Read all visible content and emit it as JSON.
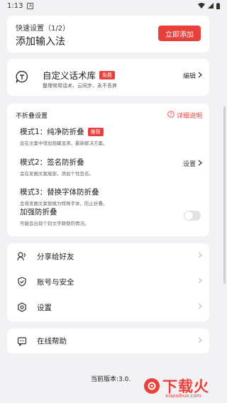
{
  "status_bar": {
    "time": "1:13",
    "notification_icon": "A"
  },
  "quick_setup": {
    "subtitle": "快速设置（1/2）",
    "title": "添加输入法",
    "button_label": "立即添加"
  },
  "phrase_library": {
    "title": "自定义话术库",
    "badge": "免费",
    "description": "整理常用话术、云同步、永不丢弃",
    "edit_label": "编辑"
  },
  "anti_fold": {
    "header": "不折叠设置",
    "help_label": "详细说明",
    "modes": [
      {
        "name": "模式1：纯净防折叠",
        "badge": "推荐",
        "description": "会在文案中增加隐藏混淆，最新解决方案。"
      },
      {
        "name": "模式2：签名防折叠",
        "description": "会在发圈文案尾部，添加个性签名。",
        "action_label": "设置"
      },
      {
        "name": "模式3：替换字体防折叠",
        "description": "会将发圈文案替换为特殊字体，防止折叠。"
      }
    ],
    "enhanced": {
      "name": "加强防折叠",
      "description": "可能会出现个别文字颠倒的情况。",
      "enabled": false
    }
  },
  "menu": {
    "items": [
      {
        "label": "分享给好友",
        "icon": "share-icon"
      },
      {
        "label": "账号与安全",
        "icon": "shield-icon"
      },
      {
        "label": "设置",
        "icon": "gear-icon"
      }
    ]
  },
  "help_item": {
    "label": "在线帮助",
    "icon": "chat-icon"
  },
  "version_text": "当前版本:3.0.",
  "watermark": {
    "text": "下载火",
    "url": "xiazaihuo.com"
  },
  "colors": {
    "accent": "#e8413c",
    "background": "#f2f2f4"
  }
}
